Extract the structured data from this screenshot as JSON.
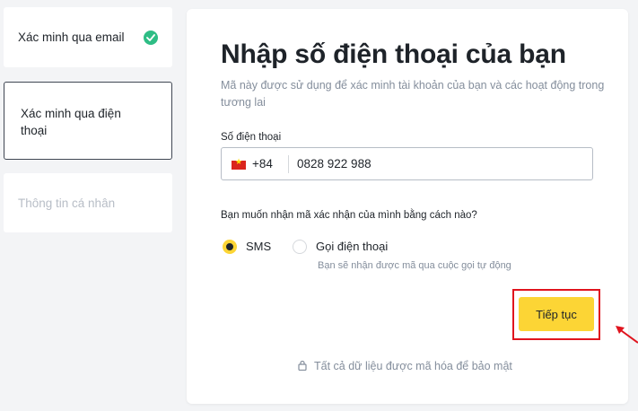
{
  "steps": [
    {
      "label": "Xác minh qua email",
      "status": "done"
    },
    {
      "label": "Xác minh qua điện thoại",
      "status": "active"
    },
    {
      "label": "Thông tin cá nhân",
      "status": "pending"
    }
  ],
  "form": {
    "title": "Nhập số điện thoại của bạn",
    "subtitle": "Mã này được sử dụng để xác minh tài khoản của bạn và các hoạt động trong tương lai",
    "phone_label": "Số điện thoại",
    "country_flag": "vietnam-flag-icon",
    "dial_code": "+84",
    "phone_value": "0828 922 988",
    "method_question": "Bạn muốn nhận mã xác nhận của mình bằng cách nào?",
    "methods": [
      {
        "label": "SMS",
        "selected": true
      },
      {
        "label": "Gọi điện thoại",
        "selected": false,
        "hint": "Bạn sẽ nhận được mã qua cuộc gọi tự động"
      }
    ],
    "continue_label": "Tiếp tục",
    "security_note": "Tất cả dữ liệu được mã hóa để bảo mật"
  },
  "colors": {
    "accent": "#fcd535",
    "success": "#2ebd85",
    "annotation": "#e0141e",
    "muted_text": "#848e9c"
  },
  "icons": {
    "completed": "check-icon",
    "security": "lock-icon",
    "annotation": "arrow-icon"
  }
}
